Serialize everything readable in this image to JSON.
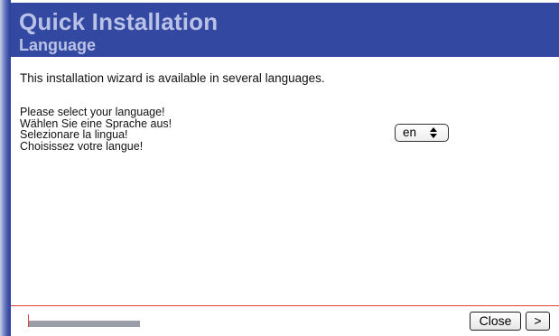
{
  "header": {
    "title": "Quick Installation",
    "subtitle": "Language"
  },
  "content": {
    "intro": "This installation wizard is available in several languages.",
    "prompts": [
      "Please select your language!",
      "Wählen Sie eine Sprache aus!",
      "Selezionare la lingua!",
      "Choisissez votre langue!"
    ]
  },
  "language_select": {
    "value": "en",
    "icon": "up-down-arrows-icon"
  },
  "footer": {
    "progress_fraction": 0.15,
    "close_label": "Close",
    "next_label": ">"
  },
  "colors": {
    "header_bg": "#3348a0",
    "header_text": "#b9c2e6",
    "divider": "#e04040"
  }
}
